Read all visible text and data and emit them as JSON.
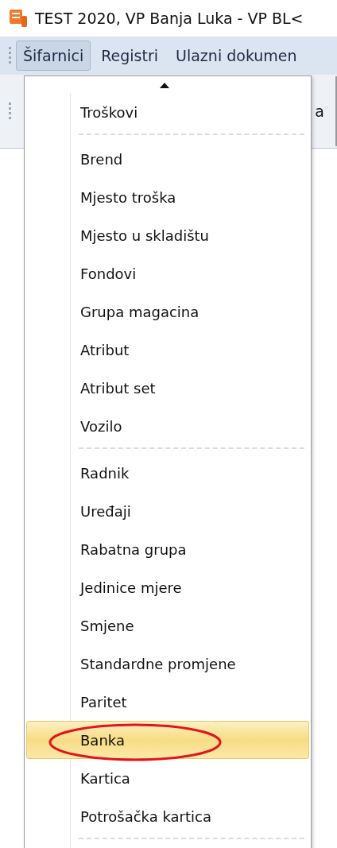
{
  "window": {
    "title": "TEST 2020, VP Banja Luka - VP BL<"
  },
  "menubar": {
    "items": [
      {
        "label": "Šifarnici",
        "selected": true
      },
      {
        "label": "Registri",
        "selected": false
      },
      {
        "label": "Ulazni dokumen",
        "selected": false
      }
    ]
  },
  "toolbar": {
    "visible_text": "a"
  },
  "dropdown": {
    "items": [
      {
        "kind": "item",
        "label": "Troškovi",
        "selected": false
      },
      {
        "kind": "separator"
      },
      {
        "kind": "item",
        "label": "Brend",
        "selected": false
      },
      {
        "kind": "item",
        "label": "Mjesto troška",
        "selected": false
      },
      {
        "kind": "item",
        "label": "Mjesto u skladištu",
        "selected": false
      },
      {
        "kind": "item",
        "label": "Fondovi",
        "selected": false
      },
      {
        "kind": "item",
        "label": "Grupa magacina",
        "selected": false
      },
      {
        "kind": "item",
        "label": "Atribut",
        "selected": false
      },
      {
        "kind": "item",
        "label": "Atribut set",
        "selected": false
      },
      {
        "kind": "item",
        "label": "Vozilo",
        "selected": false
      },
      {
        "kind": "separator"
      },
      {
        "kind": "item",
        "label": "Radnik",
        "selected": false
      },
      {
        "kind": "item",
        "label": "Uređaji",
        "selected": false
      },
      {
        "kind": "item",
        "label": "Rabatna grupa",
        "selected": false
      },
      {
        "kind": "item",
        "label": "Jedinice mjere",
        "selected": false
      },
      {
        "kind": "item",
        "label": "Smjene",
        "selected": false
      },
      {
        "kind": "item",
        "label": "Standardne promjene",
        "selected": false
      },
      {
        "kind": "item",
        "label": "Paritet",
        "selected": false
      },
      {
        "kind": "item",
        "label": "Banka",
        "selected": true,
        "circled": true
      },
      {
        "kind": "item",
        "label": "Kartica",
        "selected": false
      },
      {
        "kind": "item",
        "label": "Potrošačka kartica",
        "selected": false
      },
      {
        "kind": "separator"
      }
    ]
  }
}
